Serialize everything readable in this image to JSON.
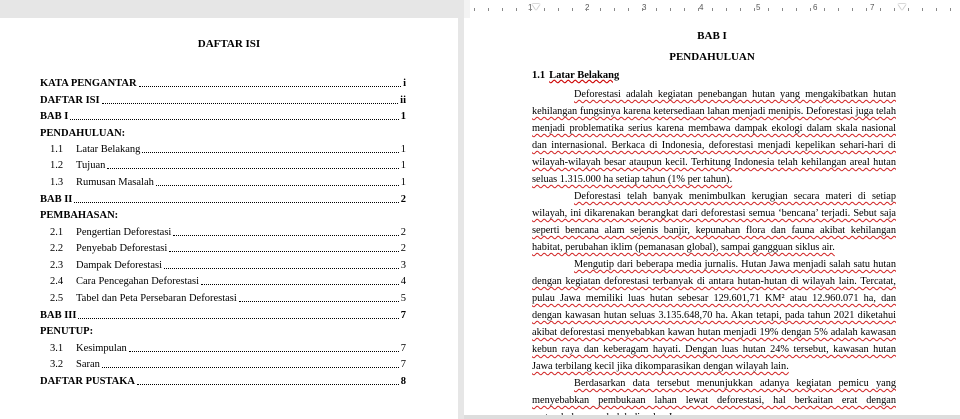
{
  "ruler": {
    "labels": [
      "1",
      "2",
      "3",
      "4",
      "5",
      "6",
      "7"
    ]
  },
  "toc": {
    "title": "DAFTAR ISI",
    "entries": [
      {
        "num": "",
        "label": "KATA PENGANTAR",
        "page": "i",
        "bold": true
      },
      {
        "num": "",
        "label": "DAFTAR ISI",
        "page": "ii",
        "bold": true
      },
      {
        "num": "",
        "label": "BAB I",
        "page": "1",
        "bold": true
      },
      {
        "num": "",
        "label": "PENDAHULUAN:",
        "page": "",
        "bold": true
      },
      {
        "num": "1.1",
        "label": "Latar Belakang",
        "page": "1",
        "bold": false
      },
      {
        "num": "1.2",
        "label": "Tujuan",
        "page": "1",
        "bold": false
      },
      {
        "num": "1.3",
        "label": "Rumusan Masalah",
        "page": "1",
        "bold": false
      },
      {
        "num": "",
        "label": "BAB II",
        "page": "2",
        "bold": true
      },
      {
        "num": "",
        "label": "PEMBAHASAN:",
        "page": "",
        "bold": true
      },
      {
        "num": "2.1",
        "label": "Pengertian Deforestasi",
        "page": "2",
        "bold": false
      },
      {
        "num": "2.2",
        "label": "Penyebab Deforestasi",
        "page": "2",
        "bold": false
      },
      {
        "num": "2.3",
        "label": "Dampak Deforestasi",
        "page": "3",
        "bold": false
      },
      {
        "num": "2.4",
        "label": "Cara Pencegahan Deforestasi",
        "page": "4",
        "bold": false
      },
      {
        "num": "2.5",
        "label": "Tabel dan Peta Persebaran Deforestasi",
        "page": "5",
        "bold": false
      },
      {
        "num": "",
        "label": "BAB III",
        "page": "7",
        "bold": true
      },
      {
        "num": "",
        "label": "PENUTUP:",
        "page": "",
        "bold": true
      },
      {
        "num": "3.1",
        "label": "Kesimpulan",
        "page": "7",
        "bold": false
      },
      {
        "num": "3.2",
        "label": "Saran",
        "page": "7",
        "bold": false
      },
      {
        "num": "",
        "label": "DAFTAR PUSTAKA",
        "page": "8",
        "bold": true
      }
    ]
  },
  "chapter": {
    "bab": "BAB I",
    "title": "PENDAHULUAN",
    "section_num": "1.1",
    "section_label": "Latar Belakang",
    "paragraphs": [
      "Deforestasi adalah kegiatan penebangan hutan yang mengakibatkan hutan kehilangan fungsinya karena ketersediaan lahan menjadi menipis. Deforestasi juga telah menjadi problematika serius karena membawa dampak ekologi dalam skala nasional dan internasional. Berkaca di Indonesia, deforestasi menjadi kepelikan sehari-hari di wilayah-wilayah besar ataupun kecil. Terhitung Indonesia telah kehilangan areal hutan seluas 1.315.000 ha setiap tahun (1% per tahun).",
      "Deforestasi telah banyak menimbulkan kerugian secara materi di setiap wilayah, ini dikarenakan berangkat dari deforestasi semua ‘bencana’ terjadi. Sebut saja seperti bencana alam sejenis banjir, kepunahan flora dan fauna akibat kehilangan habitat, perubahan iklim (pemanasan global), sampai gangguan siklus air.",
      "Mengutip dari beberapa media jurnalis. Hutan Jawa menjadi salah satu hutan dengan kegiatan deforestasi terbanyak di antara hutan-hutan di wilayah lain. Tercatat, pulau Jawa memiliki luas hutan sebesar 129.601,71 KM² atau 12.960.071 ha, dan dengan kawasan hutan seluas 3.135.648,70 ha. Akan tetapi, pada tahun 2021 diketahui akibat deforestasi menyebabkan kawan hutan menjadi 19% dengan 5% adalah kawasan kebun raya dan keberagam hayati. Dengan luas hutan 24% tersebut, kawasan hutan Jawa terbilang kecil jika dikomparasikan dengan wilayah lain.",
      "Berdasarkan data tersebut menunjukkan adanya kegiatan pemicu yang menyebabkan pembukaan lahan lewat deforestasi, hal berkaitan erat dengan pertumbuhan penduduk di pulau Jawa."
    ]
  }
}
